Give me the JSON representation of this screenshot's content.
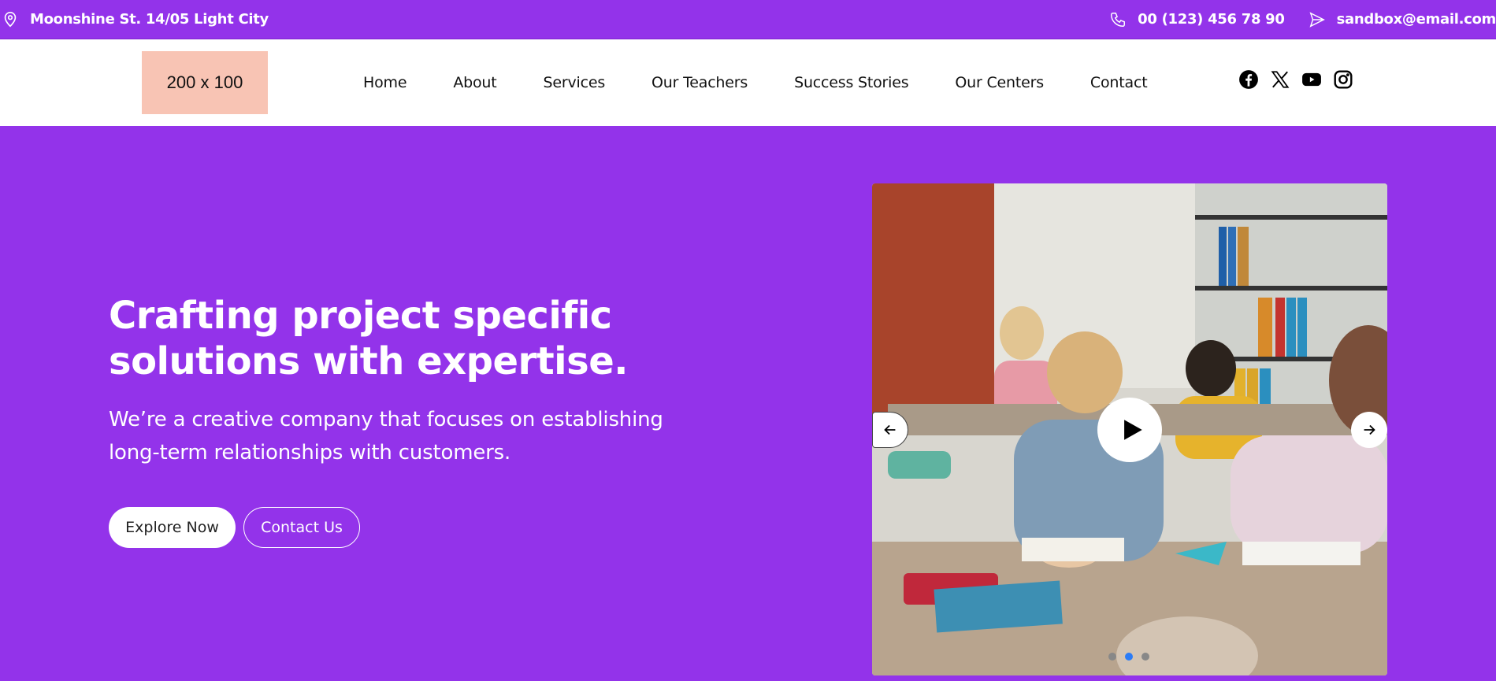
{
  "topbar": {
    "address": "Moonshine St. 14/05 Light City",
    "phone": "00 (123) 456 78 90",
    "email": "sandbox@email.com"
  },
  "header": {
    "logo_text": "200 x 100",
    "nav": [
      "Home",
      "About",
      "Services",
      "Our Teachers",
      "Success Stories",
      "Our Centers",
      "Contact"
    ],
    "social_icons": [
      "facebook-icon",
      "x-icon",
      "youtube-icon",
      "instagram-icon"
    ]
  },
  "hero": {
    "title": "Crafting project specific solutions with expertise.",
    "subtitle": "We’re a creative company that focuses on establishing long-term relationships with customers.",
    "primary_button": "Explore Now",
    "secondary_button": "Contact Us"
  },
  "slider": {
    "slide_count": 3,
    "active_index": 1
  },
  "colors": {
    "brand_purple": "#9333ea",
    "logo_placeholder": "#f8c4b4",
    "active_dot": "#2b7cf6"
  }
}
